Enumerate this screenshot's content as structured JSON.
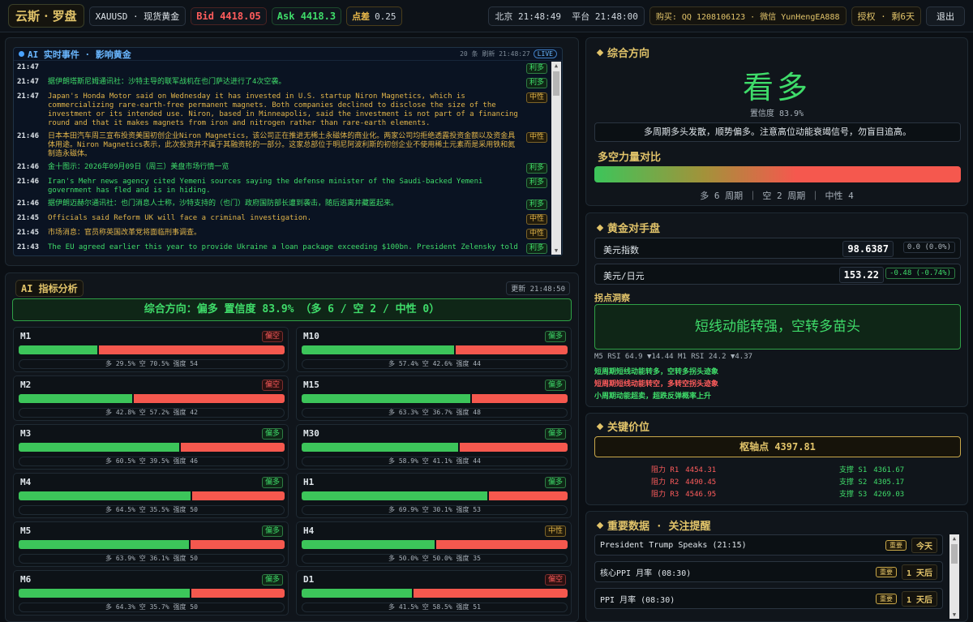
{
  "topbar": {
    "brand": "云斯 · 罗盘",
    "symbol": "XAUUSD · 现货黄金",
    "bid_label": "Bid",
    "bid": "4418.05",
    "ask_label": "Ask",
    "ask": "4418.3",
    "spread_label": "点差",
    "spread": "0.25",
    "clock_beijing_label": "北京",
    "clock_beijing": "21:48:49",
    "clock_platform_label": "平台",
    "clock_platform": "21:48:00",
    "contact": "购买: QQ 1208106123 · 微信 YunHengEA888",
    "auth": "授权 · 剩6天",
    "logout": "退出"
  },
  "news": {
    "title": "AI 实时事件 · 影响黄金",
    "meta": "20 条 刷新 21:48:27",
    "live": "LIVE",
    "items": [
      {
        "time": "21:47",
        "text": "",
        "sentiment": "bull",
        "tag": "利多"
      },
      {
        "time": "21:47",
        "text": "据伊朗塔斯尼姆通讯社：沙特主导的联军战机在也门萨达进行了4次空袭。",
        "sentiment": "bull",
        "tag": "利多"
      },
      {
        "time": "21:47",
        "text": "Japan's Honda Motor said on Wednesday it has invested in U.S. startup Niron Magnetics, which is commercializing rare-earth-free permanent magnets. Both companies declined to disclose the size of the investment or its intended use. Niron, based in Minneapolis, said the investment is not part of a financing round and that it makes magnets from iron and nitrogen rather than rare-earth elements.",
        "sentiment": "neutral",
        "tag": "中性"
      },
      {
        "time": "21:46",
        "text": "日本本田汽车周三宣布投资美国初创企业Niron Magnetics，该公司正在推进无稀土永磁体的商业化。两家公司均拒绝透露投资金额以及资金具体用途。Niron Magnetics表示，此次投资并不属于其融资轮的一部分。这家总部位于明尼阿波利斯的初创企业不使用稀土元素而是采用铁和氮制造永磁体。",
        "sentiment": "neutral",
        "tag": "中性"
      },
      {
        "time": "21:46",
        "text": "金十图示：2026年09月09日（周三）美盘市场行情一览",
        "sentiment": "bull",
        "tag": "利多"
      },
      {
        "time": "21:46",
        "text": "Iran's Mehr news agency cited Yemeni sources saying the defense minister of the Saudi-backed Yemeni government has fled and is in hiding.",
        "sentiment": "bull",
        "tag": "利多"
      },
      {
        "time": "21:46",
        "text": "据伊朗迈赫尔通讯社：也门消息人士称，沙特支持的（也门）政府国防部长遭到袭击，随后逃离并藏匿起来。",
        "sentiment": "bull",
        "tag": "利多"
      },
      {
        "time": "21:45",
        "text": "Officials said Reform UK will face a criminal investigation.",
        "sentiment": "neutral",
        "tag": "中性"
      },
      {
        "time": "21:45",
        "text": "市场消息：官员称英国改革党将面临刑事调查。",
        "sentiment": "neutral",
        "tag": "中性"
      },
      {
        "time": "21:43",
        "text": "The EU agreed earlier this year to provide Ukraine a loan package exceeding $100bn. President Zelensky told",
        "sentiment": "bull",
        "tag": "利多"
      }
    ]
  },
  "ai": {
    "title": "AI 指标分析",
    "updated": "更新 21:48:50",
    "summary": "综合方向：偏多  置信度 83.9%  （多 6 / 空 2 / 中性 0）",
    "frames": [
      {
        "name": "M1",
        "tag": "偏空",
        "kind": "bear",
        "bull": 29.5,
        "info": "多 29.5%  空 70.5%  强度 54"
      },
      {
        "name": "M10",
        "tag": "偏多",
        "kind": "bull",
        "bull": 57.4,
        "info": "多 57.4%  空 42.6%  强度 44"
      },
      {
        "name": "M2",
        "tag": "偏空",
        "kind": "bear",
        "bull": 42.8,
        "info": "多 42.8%  空 57.2%  强度 42"
      },
      {
        "name": "M15",
        "tag": "偏多",
        "kind": "bull",
        "bull": 63.3,
        "info": "多 63.3%  空 36.7%  强度 48"
      },
      {
        "name": "M3",
        "tag": "偏多",
        "kind": "bull",
        "bull": 60.5,
        "info": "多 60.5%  空 39.5%  强度 46"
      },
      {
        "name": "M30",
        "tag": "偏多",
        "kind": "bull",
        "bull": 58.9,
        "info": "多 58.9%  空 41.1%  强度 44"
      },
      {
        "name": "M4",
        "tag": "偏多",
        "kind": "bull",
        "bull": 64.5,
        "info": "多 64.5%  空 35.5%  强度 50"
      },
      {
        "name": "H1",
        "tag": "偏多",
        "kind": "bull",
        "bull": 69.9,
        "info": "多 69.9%  空 30.1%  强度 53"
      },
      {
        "name": "M5",
        "tag": "偏多",
        "kind": "bull",
        "bull": 63.9,
        "info": "多 63.9%  空 36.1%  强度 50"
      },
      {
        "name": "H4",
        "tag": "中性",
        "kind": "neutral",
        "bull": 50.0,
        "info": "多 50.0%  空 50.0%  强度 35"
      },
      {
        "name": "M6",
        "tag": "偏多",
        "kind": "bull",
        "bull": 64.3,
        "info": "多 64.3%  空 35.7%  强度 50"
      },
      {
        "name": "D1",
        "tag": "偏空",
        "kind": "bear",
        "bull": 41.5,
        "info": "多 41.5%  空 58.5%  强度 51"
      }
    ]
  },
  "direction": {
    "title": "综合方向",
    "big": "看多",
    "confidence": "置信度 83.9%",
    "note": "多周期多头发散，顺势偏多。注意高位动能衰竭信号，勿盲目追高。",
    "power_title": "多空力量对比",
    "bull_share": 0.25,
    "power_info": "多 6 周期  ｜  空 2 周期  ｜  中性 4"
  },
  "gold": {
    "title": "黄金对手盘",
    "dxy_label": "美元指数",
    "dxy_value": "98.6387",
    "dxy_change": "0.0 (0.0%)",
    "jpy_label": "美元/日元",
    "jpy_value": "153.22",
    "jpy_change": "-0.48 (-0.74%)",
    "insight_title": "拐点洞察",
    "insight": "短线动能转强，空转多苗头",
    "rsi": "M5 RSI 64.9 ▼14.44   M1 RSI 24.2 ▼4.37",
    "lines": [
      {
        "text": "短周期短线动能转多，空转多拐头迹象",
        "kind": "g"
      },
      {
        "text": "短周期短线动能转空，多转空拐头迹象",
        "kind": "r"
      },
      {
        "text": "小周期动能超卖，超跌反弹概率上升",
        "kind": "g"
      }
    ]
  },
  "keylevels": {
    "title": "关键价位",
    "pivot": "枢轴点 4397.81",
    "resistance": [
      {
        "label": "阻力 R1",
        "value": "4454.31"
      },
      {
        "label": "阻力 R2",
        "value": "4490.45"
      },
      {
        "label": "阻力 R3",
        "value": "4546.95"
      }
    ],
    "support": [
      {
        "label": "支撑 S1",
        "value": "4361.67"
      },
      {
        "label": "支撑 S2",
        "value": "4305.17"
      },
      {
        "label": "支撑 S3",
        "value": "4269.03"
      }
    ]
  },
  "events": {
    "title": "重要数据 · 关注提醒",
    "items": [
      {
        "name": "President Trump Speaks (21:15)",
        "importance": "重要",
        "when": "今天"
      },
      {
        "name": "核心PPI 月率 (08:30)",
        "importance": "重要",
        "when": "1 天后"
      },
      {
        "name": "PPI 月率 (08:30)",
        "importance": "重要",
        "when": "1 天后"
      }
    ]
  },
  "colors": {
    "bull": "#3cc55a",
    "bear": "#f5584e",
    "accent": "#e2c46a"
  }
}
